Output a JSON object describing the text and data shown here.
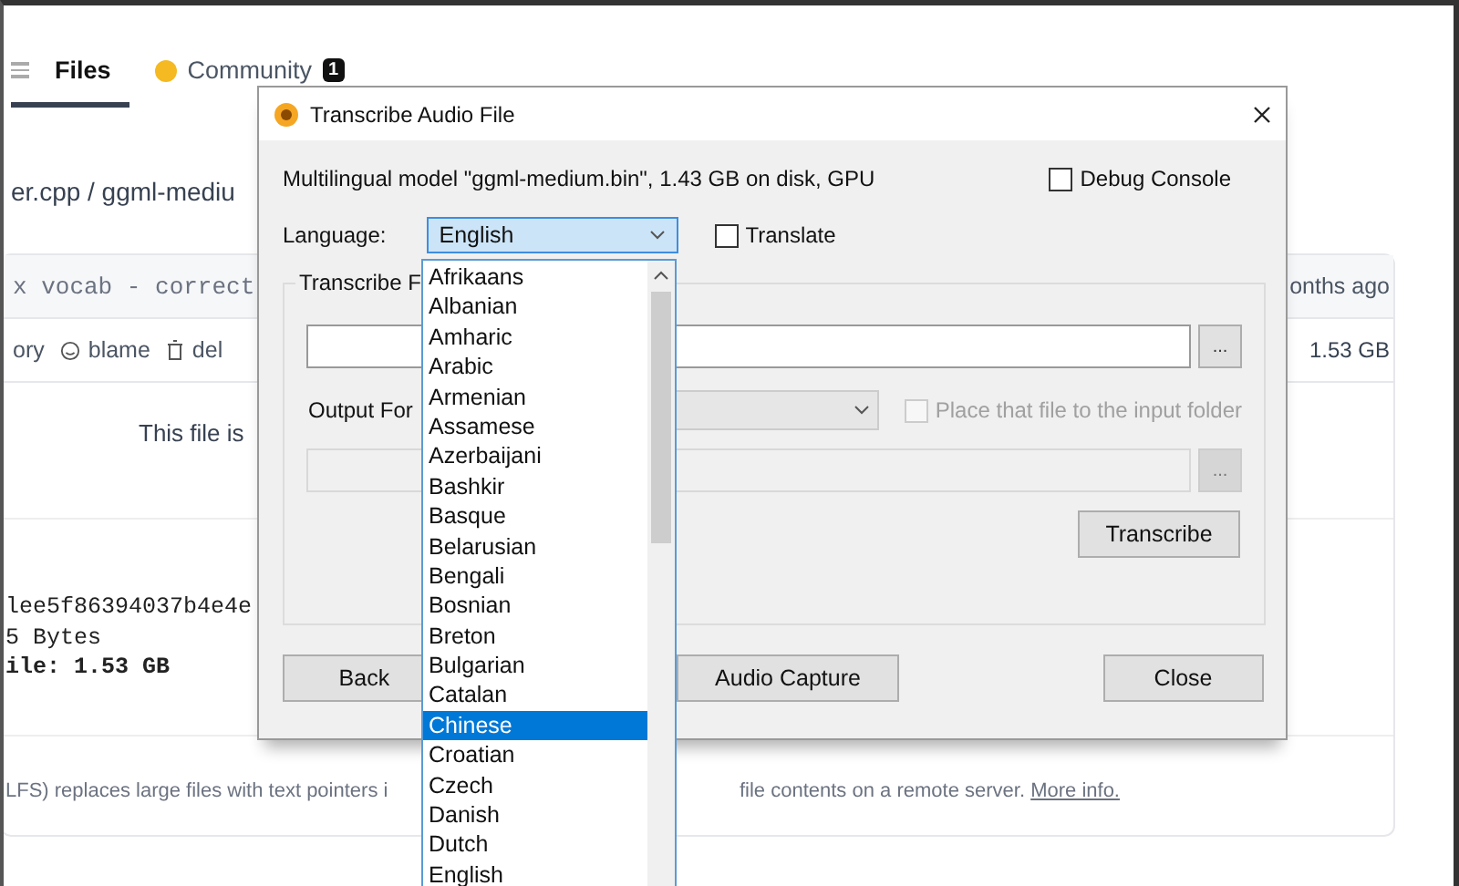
{
  "page": {
    "tabs": [
      {
        "label": "Files",
        "selected": true
      },
      {
        "label": "Community",
        "selected": false,
        "badge": "1"
      }
    ],
    "breadcrumb": "er.cpp / ggml-mediu",
    "commit_message": "x vocab - correct",
    "commit_time": "onths ago",
    "actions": [
      {
        "kind": "text",
        "label": "ory"
      },
      {
        "kind": "blame",
        "label": "blame"
      },
      {
        "kind": "delete",
        "label": "del"
      }
    ],
    "file_size": "1.53 GB",
    "notice": "This file is",
    "lfs_lines": [
      "lee5f86394037b4e4e",
      "5 Bytes",
      "ile: 1.53 GB"
    ],
    "lfs_note": "LFS) replaces large files with text pointers i",
    "lfs_note_end": "file contents on a remote server.",
    "more_info": "More info."
  },
  "dialog": {
    "title": "Transcribe Audio File",
    "model_info": "Multilingual model \"ggml-medium.bin\", 1.43 GB on disk, GPU",
    "debug_console": {
      "label": "Debug Console",
      "checked": false
    },
    "language": {
      "label": "Language:",
      "value": "English"
    },
    "translate": {
      "label": "Translate",
      "checked": false
    },
    "group_label": "Transcribe F",
    "browse_buttons": [
      {
        "label": "...",
        "disabled": false
      },
      {
        "label": "...",
        "disabled": true
      }
    ],
    "output_format": {
      "label": "Output For",
      "disabled": true
    },
    "place_in_folder": {
      "label": "Place that file to the input folder",
      "checked": false,
      "disabled": true
    },
    "transcribe_button": "Transcribe",
    "footer_buttons": [
      "Back",
      "Audio Capture",
      "Close"
    ]
  },
  "language_list": [
    {
      "label": "Afrikaans",
      "selected": false
    },
    {
      "label": "Albanian",
      "selected": false
    },
    {
      "label": "Amharic",
      "selected": false
    },
    {
      "label": "Arabic",
      "selected": false
    },
    {
      "label": "Armenian",
      "selected": false
    },
    {
      "label": "Assamese",
      "selected": false
    },
    {
      "label": "Azerbaijani",
      "selected": false
    },
    {
      "label": "Bashkir",
      "selected": false
    },
    {
      "label": "Basque",
      "selected": false
    },
    {
      "label": "Belarusian",
      "selected": false
    },
    {
      "label": "Bengali",
      "selected": false
    },
    {
      "label": "Bosnian",
      "selected": false
    },
    {
      "label": "Breton",
      "selected": false
    },
    {
      "label": "Bulgarian",
      "selected": false
    },
    {
      "label": "Catalan",
      "selected": false
    },
    {
      "label": "Chinese",
      "selected": true
    },
    {
      "label": "Croatian",
      "selected": false
    },
    {
      "label": "Czech",
      "selected": false
    },
    {
      "label": "Danish",
      "selected": false
    },
    {
      "label": "Dutch",
      "selected": false
    },
    {
      "label": "English",
      "selected": false
    }
  ]
}
